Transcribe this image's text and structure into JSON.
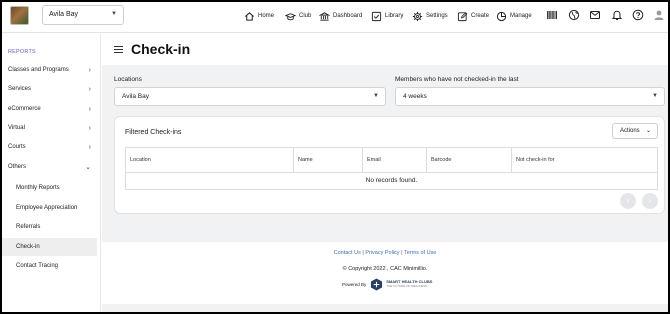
{
  "header": {
    "club_select": "Avila Bay",
    "nav": [
      {
        "label": "Home"
      },
      {
        "label": "Club"
      },
      {
        "label": "Dashboard"
      },
      {
        "label": "Library"
      },
      {
        "label": "Settings"
      },
      {
        "label": "Create"
      },
      {
        "label": "Manage"
      }
    ]
  },
  "sidebar": {
    "heading": "REPORTS",
    "items": [
      {
        "label": "Classes and Programs"
      },
      {
        "label": "Services"
      },
      {
        "label": "eCommerce"
      },
      {
        "label": "Virtual"
      },
      {
        "label": "Courts"
      },
      {
        "label": "Others"
      }
    ],
    "subitems": [
      {
        "label": "Monthly Reports"
      },
      {
        "label": "Employee Appreciation"
      },
      {
        "label": "Referrals"
      },
      {
        "label": "Check-in"
      },
      {
        "label": "Contact Tracing"
      }
    ]
  },
  "main": {
    "title": "Check-in",
    "locations_label": "Locations",
    "locations_value": "Avila Bay",
    "period_label": "Members who have not checked-in the last",
    "period_value": "4 weeks",
    "card_title": "Filtered Check-ins",
    "actions_label": "Actions",
    "columns": [
      "Location",
      "Name",
      "Email",
      "Barcode",
      "Not check-in for"
    ],
    "empty_message": "No records found."
  },
  "footer": {
    "contact": "Contact Us",
    "privacy": "Privacy Policy",
    "terms": "Terms of Use",
    "separator": "|",
    "copyright": "© Copyright 2022 , CAC Minimillio.",
    "powered_by": "Powered By",
    "brand": "SMART HEALTH CLUBS",
    "brand_tagline": "THE FUTURE OF WELLNESS"
  },
  "colors": {
    "accent": "#6a5fc0",
    "link": "#3f6fb3",
    "main_bg": "#f0f2f4"
  }
}
